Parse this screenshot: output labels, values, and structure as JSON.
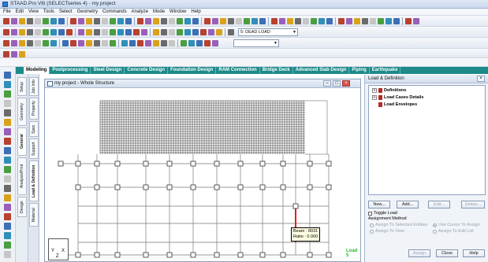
{
  "window": {
    "title": "STAAD.Pro V8i (SELECTseries 4) - my project"
  },
  "menu": [
    "File",
    "Edit",
    "View",
    "Tools",
    "Select",
    "Geometry",
    "Commands",
    "Analyze",
    "Mode",
    "Window",
    "Help"
  ],
  "toolbar": {
    "load_combo": "5: DEAD LOAD"
  },
  "tabs": [
    "Modeling",
    "Postprocessing",
    "Steel Design",
    "Concrete Design",
    "Foundation Design",
    "RAM Connection",
    "Bridge Deck",
    "Advanced Slab Design",
    "Piping",
    "Earthquake"
  ],
  "active_tab": "Modeling",
  "page_tabs": [
    "Setup",
    "Geometry",
    "General",
    "Analysis/Print",
    "Design"
  ],
  "sub_tabs": [
    "Job Info",
    "Property",
    "Spec",
    "Support",
    "Load & Definition",
    "Material"
  ],
  "structure_window": {
    "title": "my project - Whole Structure"
  },
  "tooltip": {
    "line1": "Beam : 8031",
    "line2": "Ratio : 0.000"
  },
  "load_label": "Load 5",
  "axis": {
    "y": "Y",
    "x": "X",
    "z": "Z"
  },
  "panel": {
    "title": "Load & Definition",
    "tree": [
      "Definitions",
      "Load Cases Details",
      "Load Envelopes"
    ],
    "buttons": {
      "new": "New...",
      "add": "Add...",
      "edit": "Edit...",
      "delete": "Delete..."
    },
    "toggle_load": "Toggle Load",
    "assignment_method": "Assignment Method",
    "assign_selected": "Assign To Selected Entities",
    "use_cursor": "Use Cursor To Assign",
    "assign_view": "Assign To View",
    "assign_edit": "Assign To Edit List",
    "assign_btn": "Assign",
    "close_btn": "Close",
    "help_btn": "Help"
  },
  "colors": {
    "tab_bar": "#1e8a8a",
    "selected_beam": "#e02020",
    "load_label": "#2fb82f"
  }
}
